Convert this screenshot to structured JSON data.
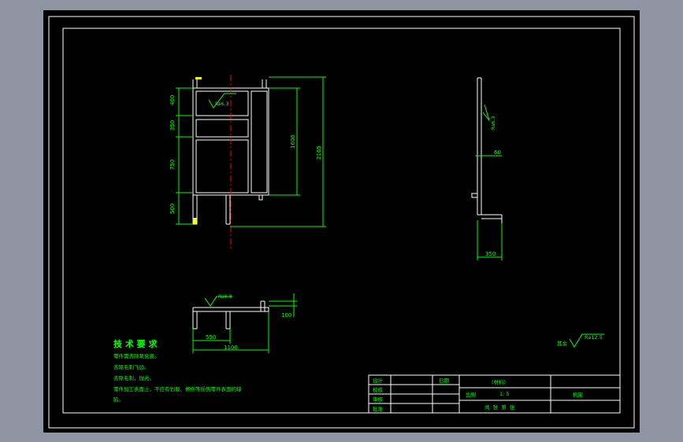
{
  "drawing": {
    "front_view": {
      "section_labels": [
        "400",
        "350",
        "750",
        "500"
      ],
      "inner_height": "1600",
      "total_height": "2165",
      "roughness": "Ra6.3"
    },
    "side_view": {
      "roughness": "Ra6.3",
      "offset": "60",
      "width": "350"
    },
    "top_view": {
      "roughness": "Ra6.3",
      "depth": "100",
      "inner": "550",
      "overall": "1100"
    },
    "technical_requirements": {
      "title": "技 术 要 求",
      "lines": [
        "零件需去除氧化皮。",
        "去除毛刺飞边。",
        "去除毛刺，抛光。",
        "零件加工表面上，不应有划痕、擦伤等损伤零件表面的缺",
        "陷。"
      ]
    },
    "rest_roughness": {
      "prefix": "其余",
      "value": "Ra12.5"
    },
    "title_block": {
      "design": "设计",
      "check": "校核",
      "review": "审核",
      "approve": "批准",
      "date": "日期",
      "material": "(材料)",
      "scale_label": "比例",
      "scale_value": "1: 5",
      "name": "机架",
      "sheets": "共  张  第  张"
    }
  }
}
